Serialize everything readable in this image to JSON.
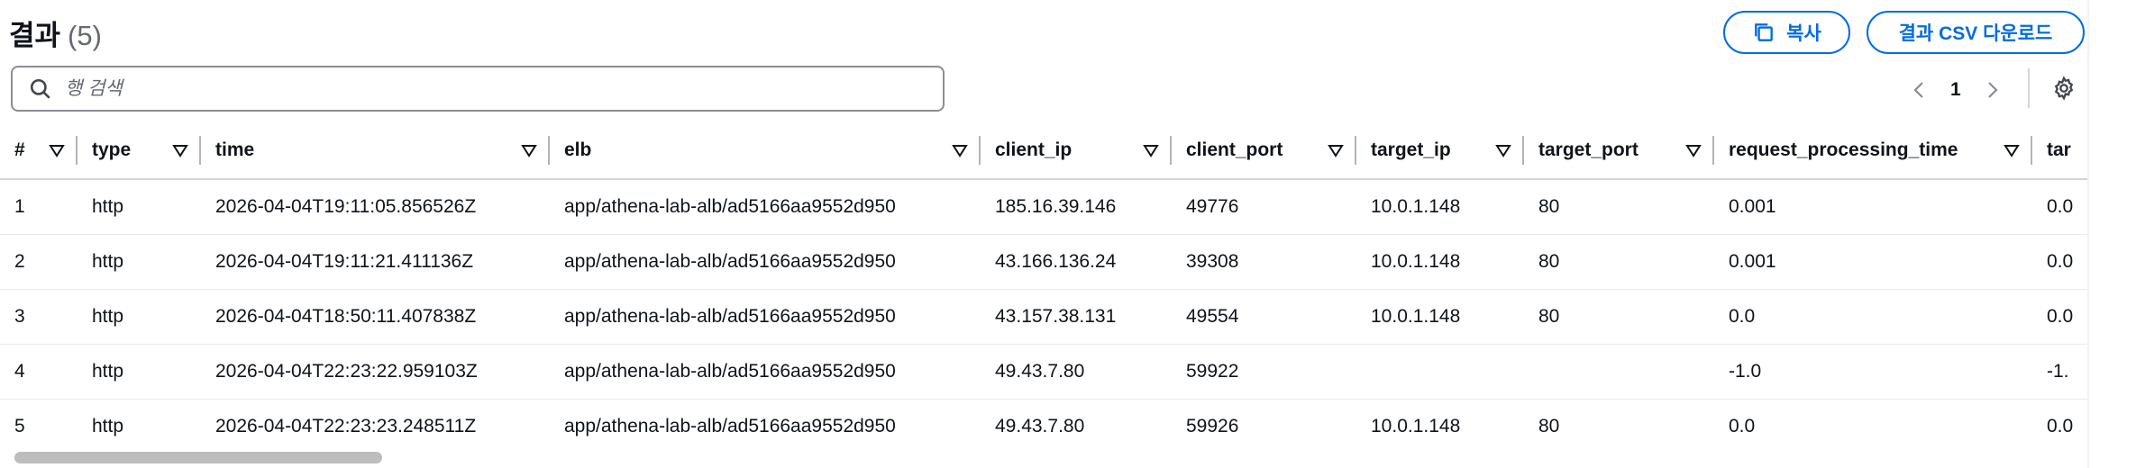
{
  "header": {
    "title": "결과",
    "count": "(5)",
    "copy_label": "복사",
    "download_label": "결과 CSV 다운로드"
  },
  "search": {
    "placeholder": "행 검색"
  },
  "pagination": {
    "current_page": "1"
  },
  "table": {
    "columns": [
      "#",
      "type",
      "time",
      "elb",
      "client_ip",
      "client_port",
      "target_ip",
      "target_port",
      "request_processing_time",
      "tar"
    ],
    "rows": [
      [
        "1",
        "http",
        "2026-04-04T19:11:05.856526Z",
        "app/athena-lab-alb/ad5166aa9552d950",
        "185.16.39.146",
        "49776",
        "10.0.1.148",
        "80",
        "0.001",
        "0.0"
      ],
      [
        "2",
        "http",
        "2026-04-04T19:11:21.411136Z",
        "app/athena-lab-alb/ad5166aa9552d950",
        "43.166.136.24",
        "39308",
        "10.0.1.148",
        "80",
        "0.001",
        "0.0"
      ],
      [
        "3",
        "http",
        "2026-04-04T18:50:11.407838Z",
        "app/athena-lab-alb/ad5166aa9552d950",
        "43.157.38.131",
        "49554",
        "10.0.1.148",
        "80",
        "0.0",
        "0.0"
      ],
      [
        "4",
        "http",
        "2026-04-04T22:23:22.959103Z",
        "app/athena-lab-alb/ad5166aa9552d950",
        "49.43.7.80",
        "59922",
        "",
        "",
        "-1.0",
        "-1."
      ],
      [
        "5",
        "http",
        "2026-04-04T22:23:23.248511Z",
        "app/athena-lab-alb/ad5166aa9552d950",
        "49.43.7.80",
        "59926",
        "10.0.1.148",
        "80",
        "0.0",
        "0.0"
      ]
    ]
  },
  "colors": {
    "accent": "#006ce0",
    "text": "#0f141a",
    "muted": "#656871"
  }
}
